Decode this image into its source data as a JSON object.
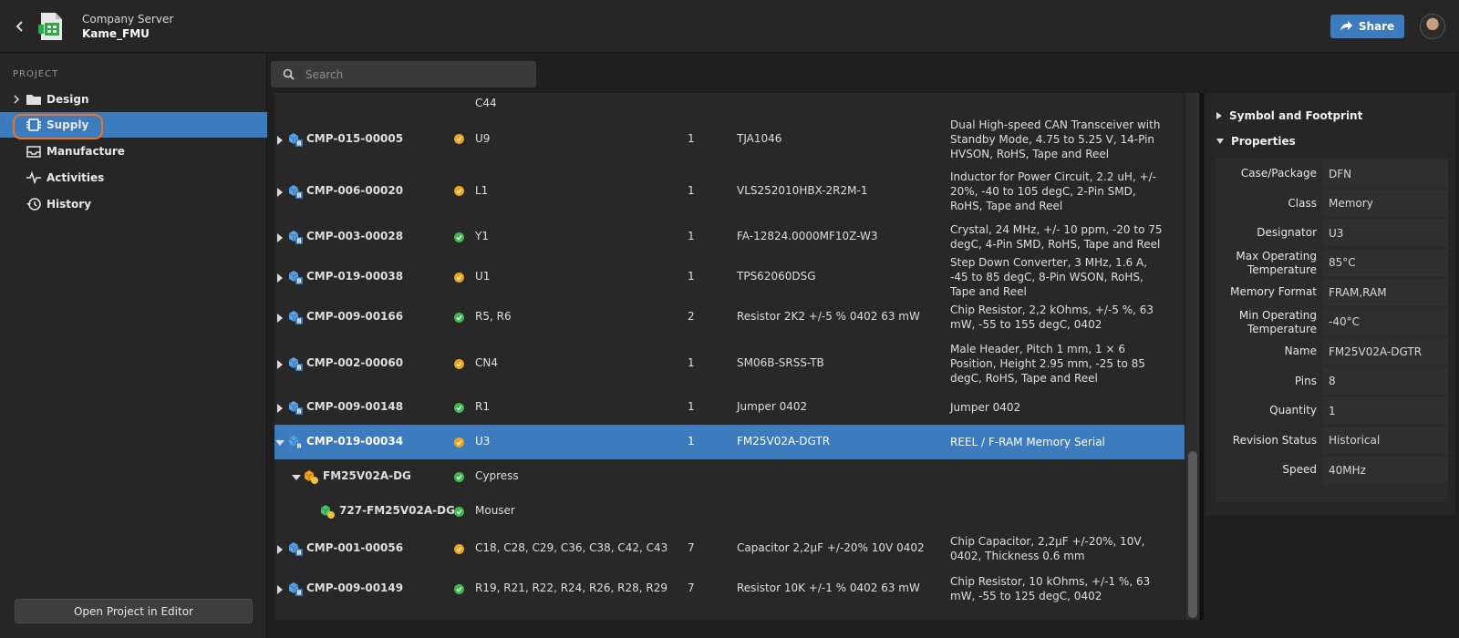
{
  "header": {
    "server": "Company Server",
    "project": "Kame_FMU",
    "share_label": "Share"
  },
  "sidebar": {
    "section_title": "PROJECT",
    "items": [
      {
        "label": "Design",
        "icon": "folder-icon"
      },
      {
        "label": "Supply",
        "icon": "chip-icon"
      },
      {
        "label": "Manufacture",
        "icon": "inbox-icon"
      },
      {
        "label": "Activities",
        "icon": "pulse-icon"
      },
      {
        "label": "History",
        "icon": "history-icon"
      }
    ],
    "active_item": "Supply",
    "open_editor_label": "Open Project in Editor"
  },
  "search": {
    "placeholder": "Search",
    "value": ""
  },
  "table": {
    "top_partial_designator": "C44",
    "rows": [
      {
        "id": "CMP-015-00005",
        "status": "warning",
        "designators": "U9",
        "qty": "1",
        "name": "TJA1046",
        "description": "Dual High-speed CAN Transceiver with Standby Mode, 4.75 to 5.25 V, 14-Pin HVSON, RoHS, Tape and Reel"
      },
      {
        "id": "CMP-006-00020",
        "status": "warning",
        "designators": "L1",
        "qty": "1",
        "name": "VLS252010HBX-2R2M-1",
        "description": "Inductor for Power Circuit, 2.2 uH, +/- 20%, -40 to 105 degC, 2-Pin SMD, RoHS, Tape and Reel"
      },
      {
        "id": "CMP-003-00028",
        "status": "ok",
        "designators": "Y1",
        "qty": "1",
        "name": "FA-12824.0000MF10Z-W3",
        "description": "Crystal, 24 MHz, +/- 10 ppm, -20 to 75 degC, 4-Pin SMD, RoHS, Tape and Reel"
      },
      {
        "id": "CMP-019-00038",
        "status": "warning",
        "designators": "U1",
        "qty": "1",
        "name": "TPS62060DSG",
        "description": "Step Down Converter, 3 MHz, 1.6 A, -45 to 85 degC, 8-Pin WSON, RoHS, Tape and Reel"
      },
      {
        "id": "CMP-009-00166",
        "status": "ok",
        "designators": "R5, R6",
        "qty": "2",
        "name": "Resistor 2K2 +/-5 % 0402 63 mW",
        "description": "Chip Resistor, 2,2 kOhms, +/-5 %, 63 mW, -55 to 155 degC, 0402"
      },
      {
        "id": "CMP-002-00060",
        "status": "warning",
        "designators": "CN4",
        "qty": "1",
        "name": "SM06B-SRSS-TB",
        "description": "Male Header, Pitch 1 mm, 1 × 6 Position, Height 2.95 mm, -25 to 85 degC, RoHS, Tape and Reel"
      },
      {
        "id": "CMP-009-00148",
        "status": "ok",
        "designators": "R1",
        "qty": "1",
        "name": "Jumper 0402",
        "description": "Jumper 0402"
      },
      {
        "id": "CMP-019-00034",
        "status": "warning",
        "designators": "U3",
        "qty": "1",
        "name": "FM25V02A-DGTR",
        "description": "REEL / F-RAM Memory Serial"
      },
      {
        "id": "FM25V02A-DG",
        "status": "ok",
        "designators": "Cypress",
        "qty": "",
        "name": "",
        "description": ""
      },
      {
        "id": "727-FM25V02A-DG",
        "status": "ok",
        "designators": "Mouser",
        "qty": "",
        "name": "",
        "description": ""
      },
      {
        "id": "CMP-001-00056",
        "status": "warning",
        "designators": "C18, C28, C29, C36, C38, C42, C43",
        "qty": "7",
        "name": "Capacitor 2,2µF +/-20% 10V 0402",
        "description": "Chip Capacitor, 2,2µF +/-20%, 10V, 0402, Thickness 0.6 mm"
      },
      {
        "id": "CMP-009-00149",
        "status": "ok",
        "designators": "R19, R21, R22, R24, R26, R28, R29",
        "qty": "7",
        "name": "Resistor 10K +/-1 % 0402 63 mW",
        "description": "Chip Resistor, 10 kOhms, +/-1 %, 63 mW, -55 to 125 degC, 0402"
      }
    ],
    "selected_row_id": "CMP-019-00034"
  },
  "details": {
    "symbol_section": "Symbol and Footprint",
    "properties_section": "Properties",
    "properties": [
      {
        "label": "Case/Package",
        "value": "DFN"
      },
      {
        "label": "Class",
        "value": "Memory"
      },
      {
        "label": "Designator",
        "value": "U3"
      },
      {
        "label": "Max Operating Temperature",
        "value": "85°C"
      },
      {
        "label": "Memory Format",
        "value": "FRAM,RAM"
      },
      {
        "label": "Min Operating Temperature",
        "value": "-40°C"
      },
      {
        "label": "Name",
        "value": "FM25V02A-DGTR"
      },
      {
        "label": "Pins",
        "value": "8"
      },
      {
        "label": "Quantity",
        "value": "1"
      },
      {
        "label": "Revision Status",
        "value": "Historical"
      },
      {
        "label": "Speed",
        "value": "40MHz"
      }
    ]
  },
  "colors": {
    "accent": "#3d7bbf",
    "highlight_ring": "#f2731a",
    "status_ok": "#3fb950",
    "status_warning": "#f0a21a"
  }
}
